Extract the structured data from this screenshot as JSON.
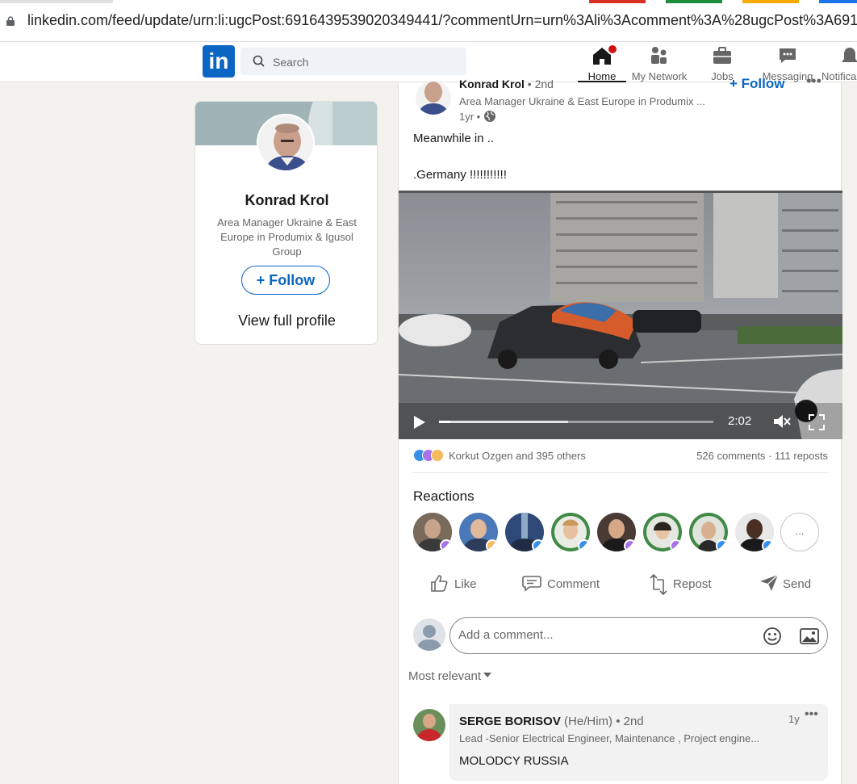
{
  "browser": {
    "url": "linkedin.com/feed/update/urn:li:ugcPost:6916439539020349441/?commentUrn=urn%3Ali%3Acomment%3A%28ugcPost%3A6916439"
  },
  "nav": {
    "logo_text": "in",
    "search_placeholder": "Search",
    "items": [
      {
        "label": "Home",
        "icon": "home-icon",
        "active": true
      },
      {
        "label": "My Network",
        "icon": "network-icon"
      },
      {
        "label": "Jobs",
        "icon": "briefcase-icon"
      },
      {
        "label": "Messaging",
        "icon": "message-icon"
      },
      {
        "label": "Notifica",
        "icon": "bell-icon"
      }
    ]
  },
  "profile": {
    "name": "Konrad Krol",
    "headline": "Area Manager Ukraine & East Europe in Produmix & Igusol Group",
    "follow_label": "+ Follow",
    "view_profile_label": "View full profile"
  },
  "post": {
    "author": "Konrad Krol",
    "degree": "• 2nd",
    "headline": "Area Manager Ukraine & East Europe in Produmix ...",
    "time": "1yr •",
    "follow_label": "+ Follow",
    "more": "•••",
    "text_line1": "Meanwhile in ..",
    "text_line2": ".Germany !!!!!!!!!!!",
    "video": {
      "duration": "2:02",
      "progress_fraction": 0.04,
      "buffered_fraction": 0.47
    },
    "reactions_summary": "Korkut Ozgen and 395 others",
    "counts": "526 comments · 111 reposts"
  },
  "reactions": {
    "title": "Reactions",
    "more_label": "..."
  },
  "actions": [
    {
      "label": "Like",
      "icon": "like-icon"
    },
    {
      "label": "Comment",
      "icon": "comment-icon"
    },
    {
      "label": "Repost",
      "icon": "repost-icon"
    },
    {
      "label": "Send",
      "icon": "send-icon"
    }
  ],
  "comment_box": {
    "placeholder": "Add a comment..."
  },
  "sort": {
    "label": "Most relevant"
  },
  "comment": {
    "name": "SERGE BORISOV",
    "pronouns": "(He/Him) • 2nd",
    "headline": "Lead -Senior Electrical Engineer, Maintenance , Project engine...",
    "text": "MOLODCY RUSSIA",
    "time": "1y",
    "more": "•••"
  },
  "colors": {
    "brand": "#0a66c2",
    "background": "#f3f2ef",
    "notification": "#cc1016"
  }
}
